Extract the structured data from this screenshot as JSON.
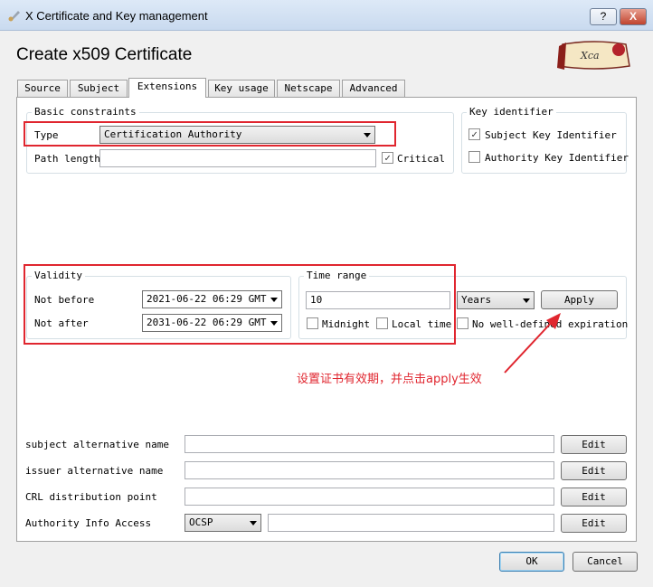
{
  "window": {
    "title": "X Certificate and Key management",
    "help_button": "?",
    "close_button": "X"
  },
  "heading": "Create x509 Certificate",
  "logo": {
    "text": "Xca"
  },
  "tabs": [
    "Source",
    "Subject",
    "Extensions",
    "Key usage",
    "Netscape",
    "Advanced"
  ],
  "active_tab": "Extensions",
  "basic_constraints": {
    "title": "Basic constraints",
    "type_label": "Type",
    "type_value": "Certification Authority",
    "path_length_label": "Path length",
    "path_length_value": "",
    "critical_label": "Critical",
    "critical_checked": true
  },
  "key_identifier": {
    "title": "Key identifier",
    "subject_label": "Subject Key Identifier",
    "subject_checked": true,
    "authority_label": "Authority Key Identifier",
    "authority_checked": false
  },
  "validity": {
    "title": "Validity",
    "not_before_label": "Not before",
    "not_before_value": "2021-06-22 06:29 GMT",
    "not_after_label": "Not after",
    "not_after_value": "2031-06-22 06:29 GMT"
  },
  "time_range": {
    "title": "Time range",
    "value": "10",
    "unit": "Years",
    "apply_label": "Apply",
    "midnight_label": "Midnight",
    "local_time_label": "Local time",
    "no_expiration_label": "No well-defined expiration"
  },
  "annotation": "设置证书有效期，并点击apply生效",
  "extensions": {
    "san_label": "subject alternative name",
    "ian_label": "issuer alternative name",
    "crl_label": "CRL distribution point",
    "aia_label": "Authority Info Access",
    "aia_method": "OCSP",
    "edit_label": "Edit"
  },
  "footer": {
    "ok_label": "OK",
    "cancel_label": "Cancel"
  },
  "colors": {
    "highlight": "#e0262f",
    "titlebar": "#dde9f7"
  }
}
